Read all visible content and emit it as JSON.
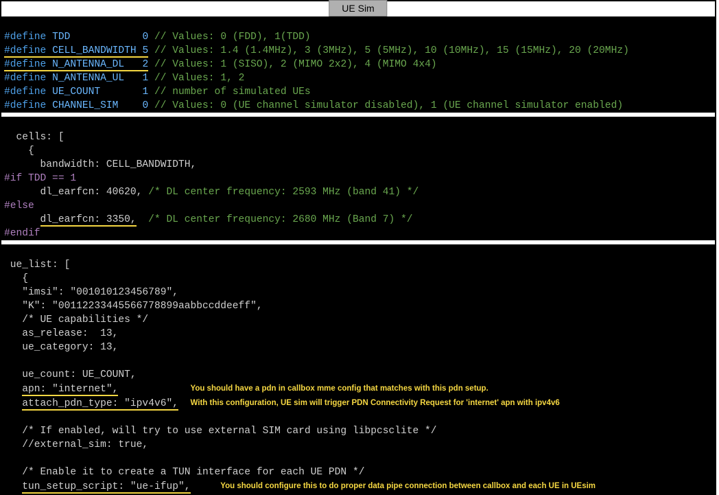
{
  "title": "UE Sim",
  "defines": {
    "tdd": {
      "kw": "#define",
      "name": "TDD",
      "val": "0",
      "com": "// Values: 0 (FDD), 1(TDD)"
    },
    "cbw": {
      "kw": "#define",
      "name": "CELL_BANDWIDTH",
      "val": "5",
      "com": "// Values: 1.4 (1.4MHz), 3 (3MHz), 5 (5MHz), 10 (10MHz), 15 (15MHz), 20 (20MHz)"
    },
    "ndl": {
      "kw": "#define",
      "name": "N_ANTENNA_DL",
      "val": "2",
      "com": "// Values: 1 (SISO), 2 (MIMO 2x2), 4 (MIMO 4x4)"
    },
    "nul": {
      "kw": "#define",
      "name": "N_ANTENNA_UL",
      "val": "1",
      "com": "// Values: 1, 2"
    },
    "uec": {
      "kw": "#define",
      "name": "UE_COUNT",
      "val": "1",
      "com": "// number of simulated UEs"
    },
    "chs": {
      "kw": "#define",
      "name": "CHANNEL_SIM",
      "val": "0",
      "com": "// Values: 0 (UE channel simulator disabled), 1 (UE channel simulator enabled)"
    }
  },
  "cells": {
    "l1": "  cells: [",
    "l2": "    {",
    "l3": "      bandwidth: CELL_BANDWIDTH,",
    "if": "#if TDD == 1",
    "l4a": "      dl_earfcn: 40620,",
    "l4b": " /* DL center frequency: 2593 MHz (band 41) */",
    "else": "#else",
    "l5a_pre": "      ",
    "l5a": "dl_earfcn: 3350,",
    "l5b": "  /* DL center frequency: 2680 MHz (Band 7) */",
    "endif": "#endif"
  },
  "uelist": {
    "l1": " ue_list: [",
    "l2": "   {",
    "l3": "   \"imsi\": \"001010123456789\",",
    "l4": "   \"K\": \"00112233445566778899aabbccddeeff\",",
    "l5": "   /* UE capabilities */",
    "l6": "   as_release:  13,",
    "l7": "   ue_category: 13,",
    "blank1": "",
    "l8": "   ue_count: UE_COUNT,",
    "l9pre": "   ",
    "l9": "apn: \"internet\",",
    "l10pre": "   ",
    "l10": "attach_pdn_type: \"ipv4v6\",",
    "blank2": "",
    "l11": "   /* If enabled, will try to use external SIM card using libpcsclite */",
    "l12": "   //external_sim: true,",
    "blank3": "",
    "l13": "   /* Enable it to create a TUN interface for each UE PDN */",
    "l14pre": "   ",
    "l14": "tun_setup_script: \"ue-ifup\","
  },
  "ann": {
    "pdn1": "You should have a pdn in callbox mme config that matches with this pdn setup.",
    "pdn2": "With this configuration, UE sim will trigger PDN Connectivity Request for 'internet' apn with ipv4v6",
    "tun": "You should configure this to do proper data pipe connection between callbox and each UE in UEsim"
  }
}
